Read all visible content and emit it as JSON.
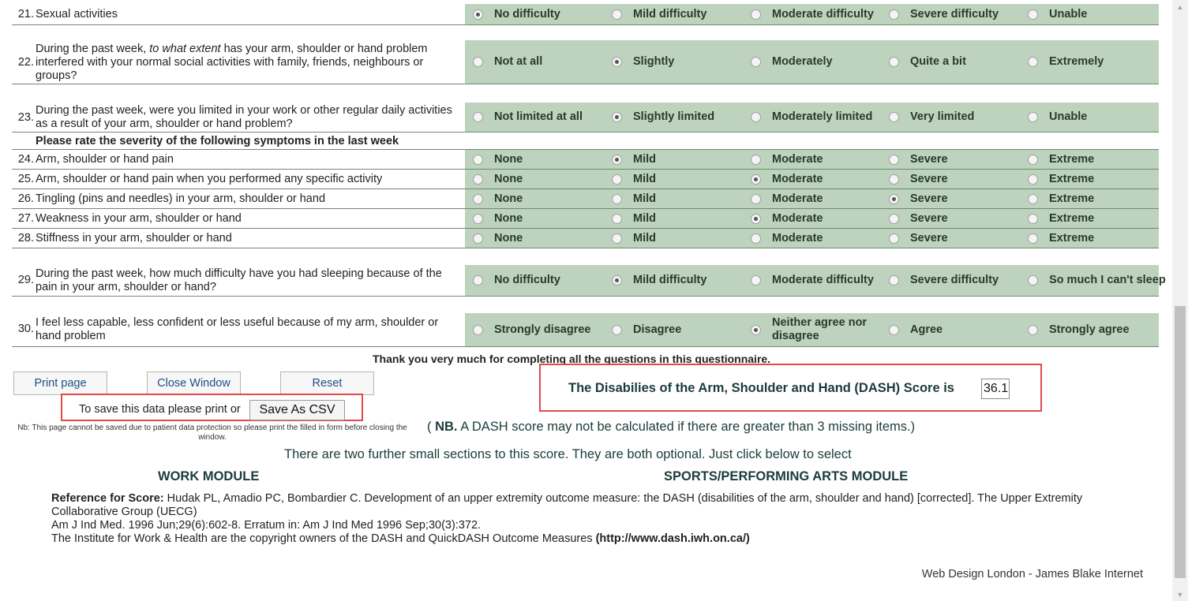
{
  "questions": [
    {
      "num": "21.",
      "text": "Sexual activities",
      "options": [
        "No difficulty",
        "Mild difficulty",
        "Moderate difficulty",
        "Severe difficulty",
        "Unable"
      ],
      "selected": 0
    },
    {
      "num": "22.",
      "text_prefix": "During the past week, ",
      "text_em": "to what extent",
      "text_suffix": " has your arm, shoulder or hand problem interfered with your normal social activities with family, friends, neighbours or groups?",
      "options": [
        "Not at all",
        "Slightly",
        "Moderately",
        "Quite a bit",
        "Extremely"
      ],
      "selected": 1
    },
    {
      "num": "23.",
      "text": "During the past week, were you limited in your work or other regular daily activities as a result of your arm, shoulder or hand problem?",
      "options": [
        "Not limited at all",
        "Slightly limited",
        "Moderately limited",
        "Very limited",
        "Unable"
      ],
      "selected": 1
    },
    {
      "num": "24.",
      "text": "Arm, shoulder or hand pain",
      "options": [
        "None",
        "Mild",
        "Moderate",
        "Severe",
        "Extreme"
      ],
      "selected": 1
    },
    {
      "num": "25.",
      "text": "Arm, shoulder or hand pain when you performed any specific activity",
      "options": [
        "None",
        "Mild",
        "Moderate",
        "Severe",
        "Extreme"
      ],
      "selected": 2
    },
    {
      "num": "26.",
      "text": "Tingling (pins and needles) in your arm, shoulder or hand",
      "options": [
        "None",
        "Mild",
        "Moderate",
        "Severe",
        "Extreme"
      ],
      "selected": 3
    },
    {
      "num": "27.",
      "text": "Weakness in your arm, shoulder or hand",
      "options": [
        "None",
        "Mild",
        "Moderate",
        "Severe",
        "Extreme"
      ],
      "selected": 2
    },
    {
      "num": "28.",
      "text": "Stiffness in your arm, shoulder or hand",
      "options": [
        "None",
        "Mild",
        "Moderate",
        "Severe",
        "Extreme"
      ],
      "selected": null
    },
    {
      "num": "29.",
      "text": "During the past week, how much difficulty have you had sleeping because of the pain in your arm, shoulder or hand?",
      "options": [
        "No difficulty",
        "Mild difficulty",
        "Moderate difficulty",
        "Severe difficulty",
        "So much I can't sleep"
      ],
      "selected": 1
    },
    {
      "num": "30.",
      "text": "I feel less capable, less confident or less useful because of my arm, shoulder or hand problem",
      "options": [
        "Strongly disagree",
        "Disagree",
        "Neither agree nor disagree",
        "Agree",
        "Strongly agree"
      ],
      "selected": 2
    }
  ],
  "section_heading": "Please rate the severity of the following symptoms in the last week",
  "thanks": "Thank you very much for completing all the questions in this questionnaire.",
  "buttons": {
    "print": "Print page",
    "close": "Close Window",
    "reset": "Reset",
    "csv": "Save As CSV"
  },
  "save_text": "To save this data please print or",
  "nb_small": "Nb: This page cannot be saved due to patient data protection so please print the filled in form before closing the window.",
  "score": {
    "label": "The Disabilies of the Arm, Shoulder and Hand (DASH) Score is",
    "value": "36.1"
  },
  "nb_line": {
    "open": "( ",
    "bold": "NB.",
    "rest": " A DASH score may not be calculated if there are greater than 3 missing items.)"
  },
  "further": "There are two further small sections to this score. They are both optional. Just click below to select",
  "modules": {
    "work": "WORK MODULE",
    "sports": "SPORTS/PERFORMING ARTS MODULE"
  },
  "reference": {
    "label": "Reference for Score:",
    "line1": " Hudak PL, Amadio PC, Bombardier C. Development of an upper extremity outcome measure: the DASH (disabilities of the arm, shoulder and hand) [corrected]. The Upper Extremity Collaborative Group (UECG)",
    "line2": "Am J Ind Med. 1996 Jun;29(6):602-8. Erratum in: Am J Ind Med 1996 Sep;30(3):372.",
    "line3": "The Institute for Work & Health are the copyright owners of the DASH and QuickDASH Outcome Measures ",
    "link": "(http://www.dash.iwh.on.ca/)"
  },
  "footer": "Web Design London - James Blake Internet",
  "colors": {
    "option_band": "#bdd3bd",
    "highlight_box": "#e24a4a",
    "heading": "#1c3b3b"
  }
}
